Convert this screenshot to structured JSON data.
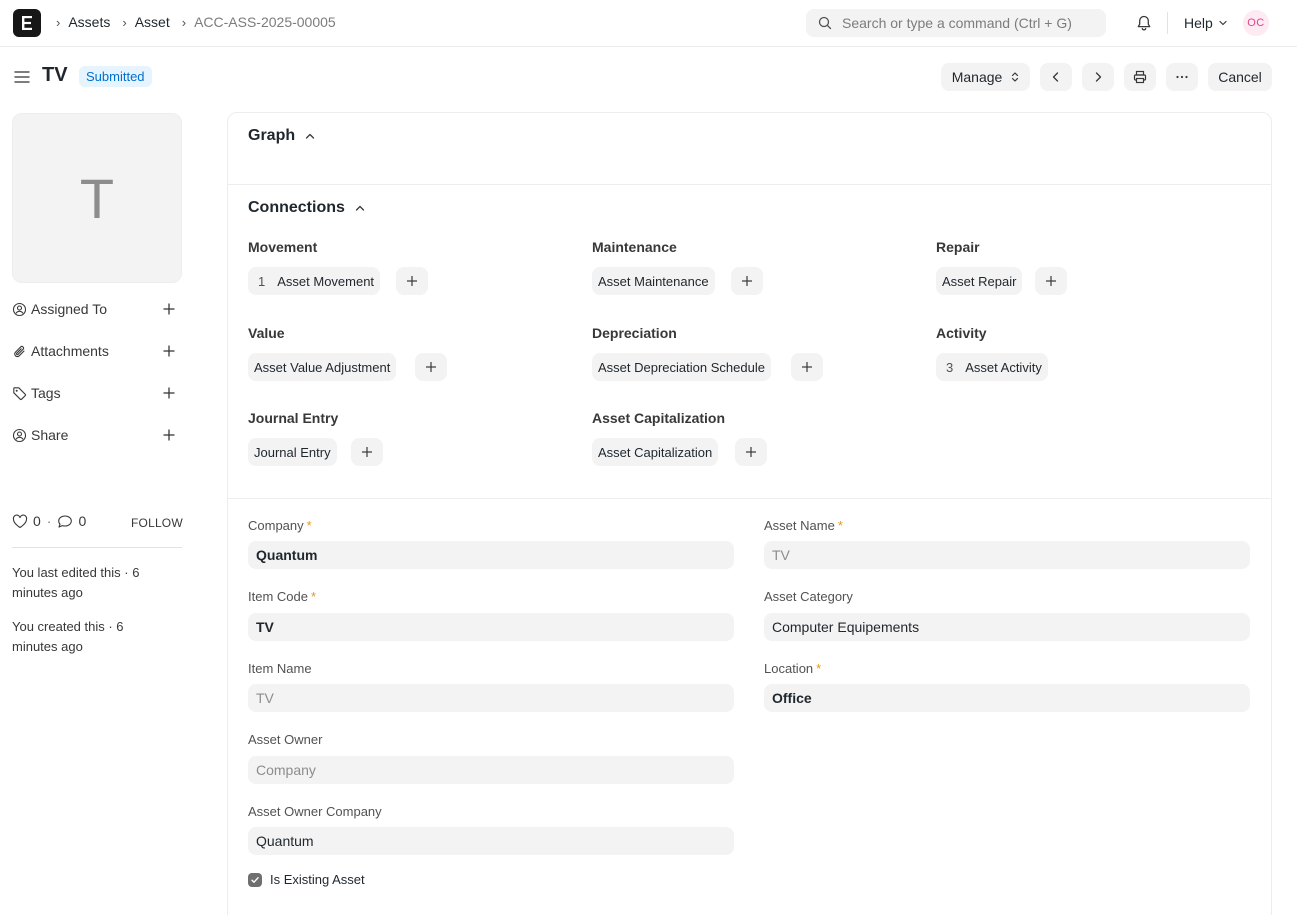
{
  "navbar": {
    "logo_letter": "E",
    "breadcrumbs": [
      "Assets",
      "Asset",
      "ACC-ASS-2025-00005"
    ],
    "search_placeholder": "Search or type a command (Ctrl + G)",
    "help_label": "Help",
    "user_initials": "OC"
  },
  "page": {
    "title": "TV",
    "status": "Submitted",
    "buttons": {
      "manage": "Manage",
      "cancel": "Cancel"
    }
  },
  "sidebar": {
    "image_letter": "T",
    "items": [
      {
        "label": "Assigned To",
        "icon": "assign-icon"
      },
      {
        "label": "Attachments",
        "icon": "paperclip-icon"
      },
      {
        "label": "Tags",
        "icon": "tag-icon"
      },
      {
        "label": "Share",
        "icon": "share-icon"
      }
    ],
    "likes": "0",
    "comments": "0",
    "follow": "FOLLOW",
    "activity": [
      "You last edited this · 6 minutes ago",
      "You created this · 6 minutes ago"
    ]
  },
  "sections": {
    "graph": "Graph",
    "connections": "Connections"
  },
  "connections": [
    {
      "group": "Movement",
      "item": "Asset Movement",
      "count": "1"
    },
    {
      "group": "Maintenance",
      "item": "Asset Maintenance",
      "count": ""
    },
    {
      "group": "Repair",
      "item": "Asset Repair",
      "count": ""
    },
    {
      "group": "Value",
      "item": "Asset Value Adjustment",
      "count": ""
    },
    {
      "group": "Depreciation",
      "item": "Asset Depreciation Schedule",
      "count": ""
    },
    {
      "group": "Activity",
      "item": "Asset Activity",
      "count": "3"
    },
    {
      "group": "Journal Entry",
      "item": "Journal Entry",
      "count": ""
    },
    {
      "group": "Asset Capitalization",
      "item": "Asset Capitalization",
      "count": ""
    }
  ],
  "fields": {
    "company": {
      "label": "Company",
      "value": "Quantum"
    },
    "item_code": {
      "label": "Item Code",
      "value": "TV"
    },
    "item_name": {
      "label": "Item Name",
      "value": "TV"
    },
    "asset_owner": {
      "label": "Asset Owner",
      "value": "Company"
    },
    "asset_owner_company": {
      "label": "Asset Owner Company",
      "value": "Quantum"
    },
    "asset_name": {
      "label": "Asset Name",
      "value": "TV"
    },
    "asset_category": {
      "label": "Asset Category",
      "value": "Computer Equipements"
    },
    "location": {
      "label": "Location",
      "value": "Office"
    },
    "required_marker": "*"
  },
  "checkbox": {
    "label": "Is Existing Asset",
    "checked": true
  },
  "colors": {
    "accent": "#0070cc",
    "badge_bg": "#e6f4ff",
    "required": "#e79913"
  }
}
